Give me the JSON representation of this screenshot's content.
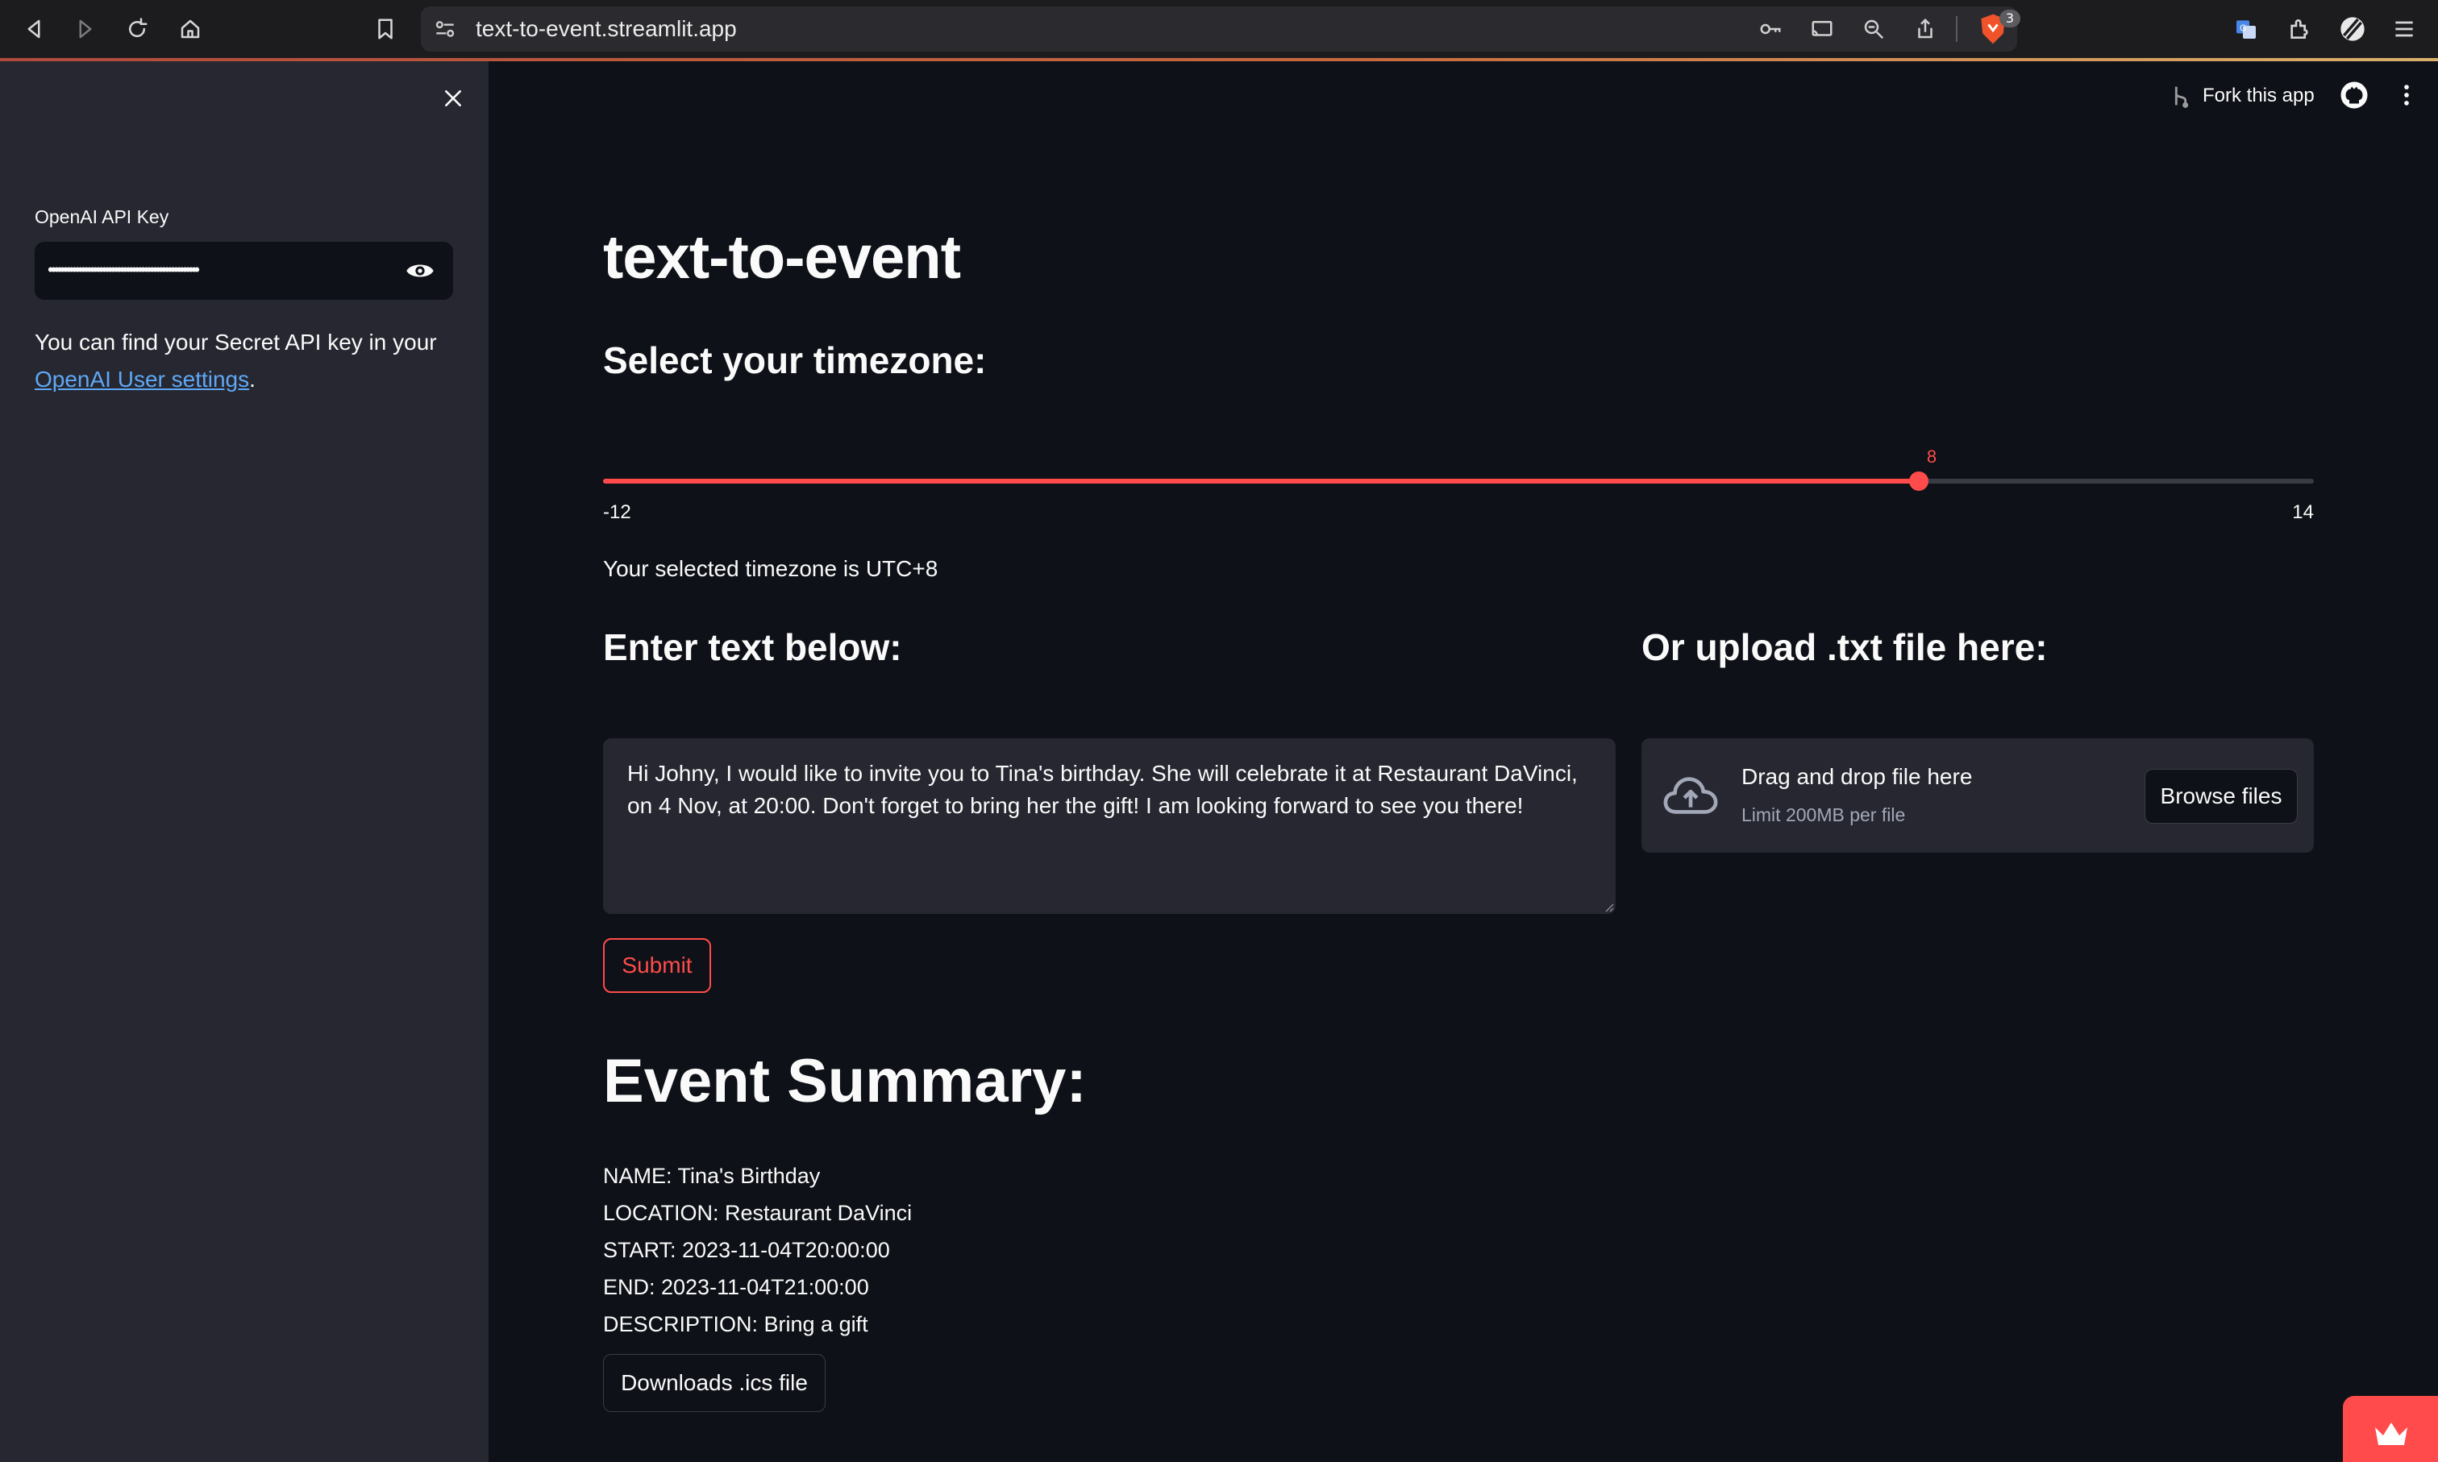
{
  "browser": {
    "url": "text-to-event.streamlit.app",
    "brave_badge_count": "3"
  },
  "sidebar": {
    "api_key_label": "OpenAI API Key",
    "api_key_masked": "••••••••••••••••••••••••••••••••••••••••••••••••••",
    "help_text_prefix": "You can find your Secret API key in your ",
    "help_link_text": "OpenAI User settings",
    "help_text_suffix": "."
  },
  "header": {
    "fork_label": "Fork this app"
  },
  "main": {
    "title": "text-to-event",
    "timezone_heading": "Select your timezone:",
    "slider": {
      "value": 8,
      "value_label": "8",
      "min": -12,
      "max": 14,
      "min_label": "-12",
      "max_label": "14"
    },
    "timezone_text": "Your selected timezone is UTC+8",
    "enter_heading": "Enter text below:",
    "upload_heading": "Or upload .txt file here:",
    "textarea_value": "Hi Johny, I would like to invite you to Tina's birthday. She will celebrate it at Restaurant DaVinci, on 4 Nov, at 20:00. Don't forget to bring her the gift! I am looking forward to see you there!",
    "uploader": {
      "title": "Drag and drop file here",
      "subtitle": "Limit 200MB per file",
      "browse_label": "Browse files"
    },
    "submit_label": "Submit",
    "summary_heading": "Event Summary:",
    "summary_lines": [
      "NAME: Tina's Birthday",
      "LOCATION: Restaurant DaVinci",
      "START: 2023-11-04T20:00:00",
      "END: 2023-11-04T21:00:00",
      "DESCRIPTION: Bring a gift"
    ],
    "download_label": "Downloads .ics file"
  },
  "colors": {
    "accent": "#ff4b4b",
    "background": "#0e1117",
    "sidebar": "#262730",
    "link": "#5fa8f5"
  }
}
